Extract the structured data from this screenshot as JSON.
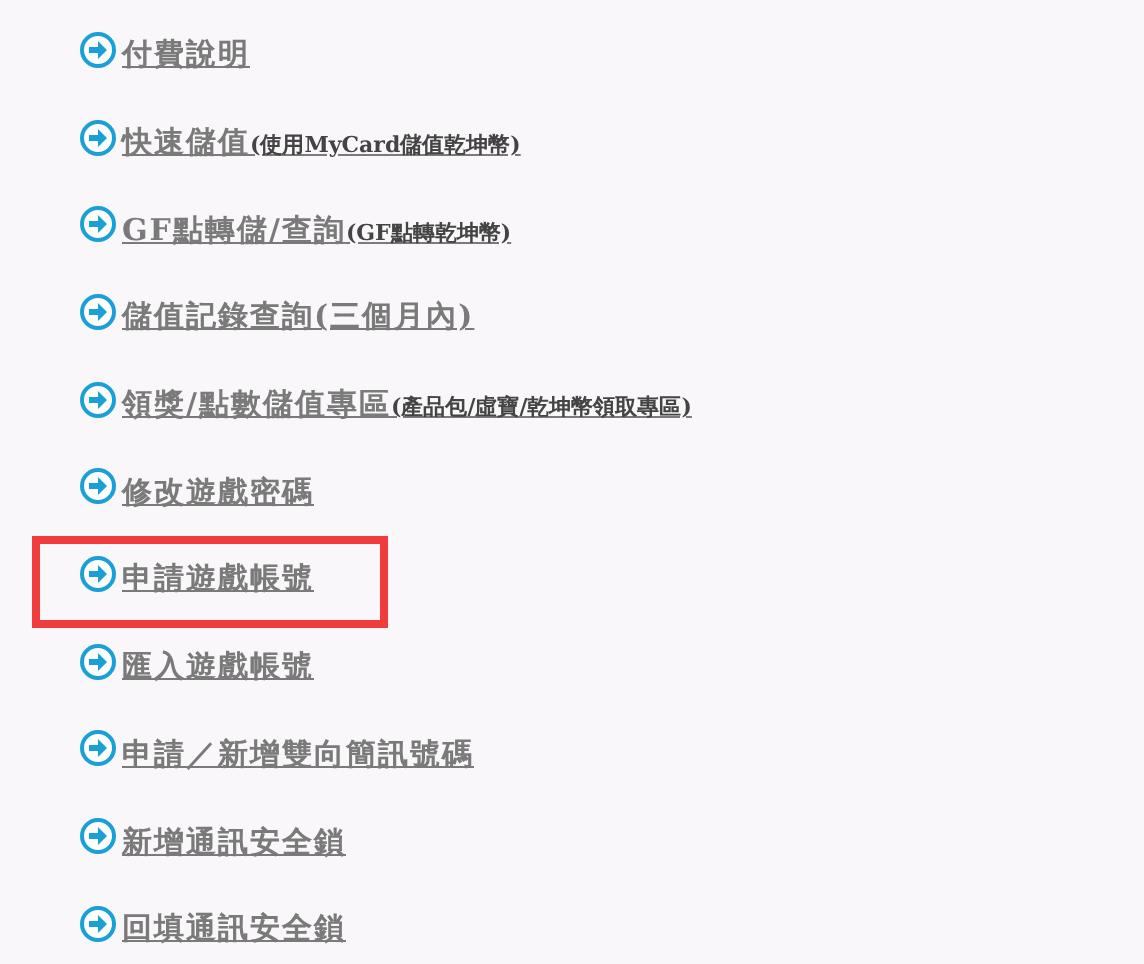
{
  "links": [
    {
      "label": "付費說明",
      "highlighted": false
    },
    {
      "label": "快速儲值",
      "note": "(使用MyCard儲值乾坤幣)",
      "highlighted": false
    },
    {
      "label": "GF點轉儲/查詢",
      "note": "(GF點轉乾坤幣)",
      "highlighted": false
    },
    {
      "label": "儲值記錄查詢(三個月內)",
      "highlighted": false
    },
    {
      "label": "領獎/點數儲值專區",
      "note": "(產品包/虛寶/乾坤幣領取專區)",
      "highlighted": false
    },
    {
      "label": "修改遊戲密碼",
      "highlighted": false
    },
    {
      "label": "申請遊戲帳號",
      "highlighted": true
    },
    {
      "label": "匯入遊戲帳號",
      "highlighted": false
    },
    {
      "label": "申請／新增雙向簡訊號碼",
      "highlighted": false
    },
    {
      "label": "新增通訊安全鎖",
      "highlighted": false
    },
    {
      "label": "回填通訊安全鎖",
      "highlighted": false
    }
  ]
}
